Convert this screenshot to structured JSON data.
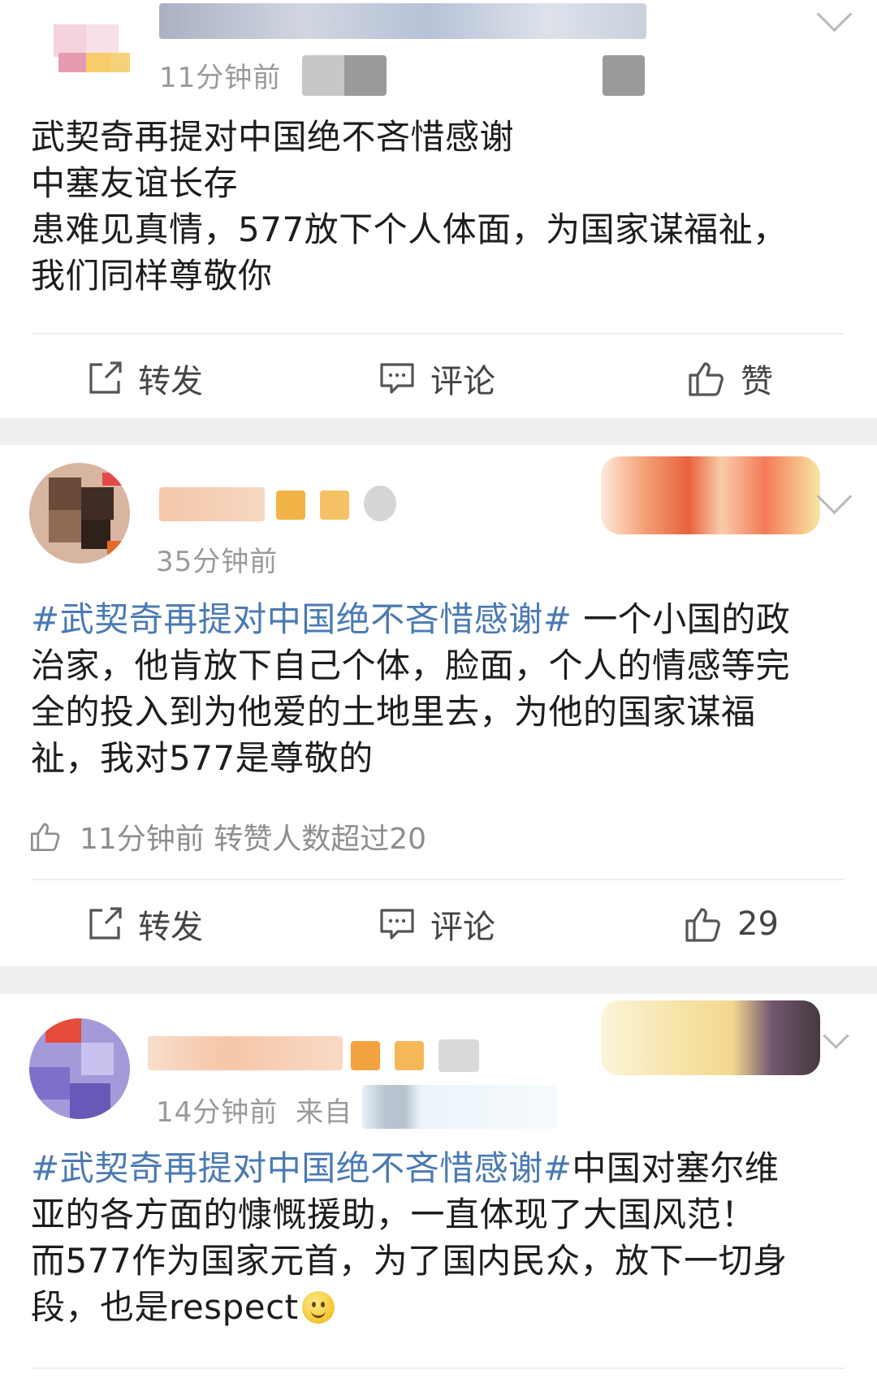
{
  "posts": [
    {
      "time": "11分钟前",
      "content_lines": [
        "武契奇再提对中国绝不吝惜感谢",
        "中塞友谊长存",
        "患难见真情，577放下个人体面，为国家谋福祉，",
        "我们同样尊敬你"
      ],
      "actions": {
        "repost_label": "转发",
        "comment_label": "评论",
        "like_label": "赞"
      }
    },
    {
      "time": "35分钟前",
      "tag": "#武契奇再提对中国绝不吝惜感谢#",
      "content_lines": [
        " 一个小国的政",
        "治家，他肯放下自己个体，脸面，个人的情感等完",
        "全的投入到为他爱的土地里去，为他的国家谋福",
        "祉，我对577是尊敬的"
      ],
      "liked_info": "11分钟前 转赞人数超过20",
      "actions": {
        "repost_label": "转发",
        "comment_label": "评论",
        "like_count": "29"
      }
    },
    {
      "time": "14分钟前",
      "source_prefix": "来自",
      "tag": "#武契奇再提对中国绝不吝惜感谢#",
      "content_lines": [
        "中国对塞尔维",
        "亚的各方面的慷慨援助，一直体现了大国风范！",
        "而577作为国家元首，为了国内民众，放下一切身",
        "段，也是respect"
      ],
      "emoji": "smile-emoji"
    }
  ],
  "colors": {
    "hashtag": "#4a7ab3",
    "separator": "#efefef",
    "timestamp": "#9a9a9a"
  }
}
